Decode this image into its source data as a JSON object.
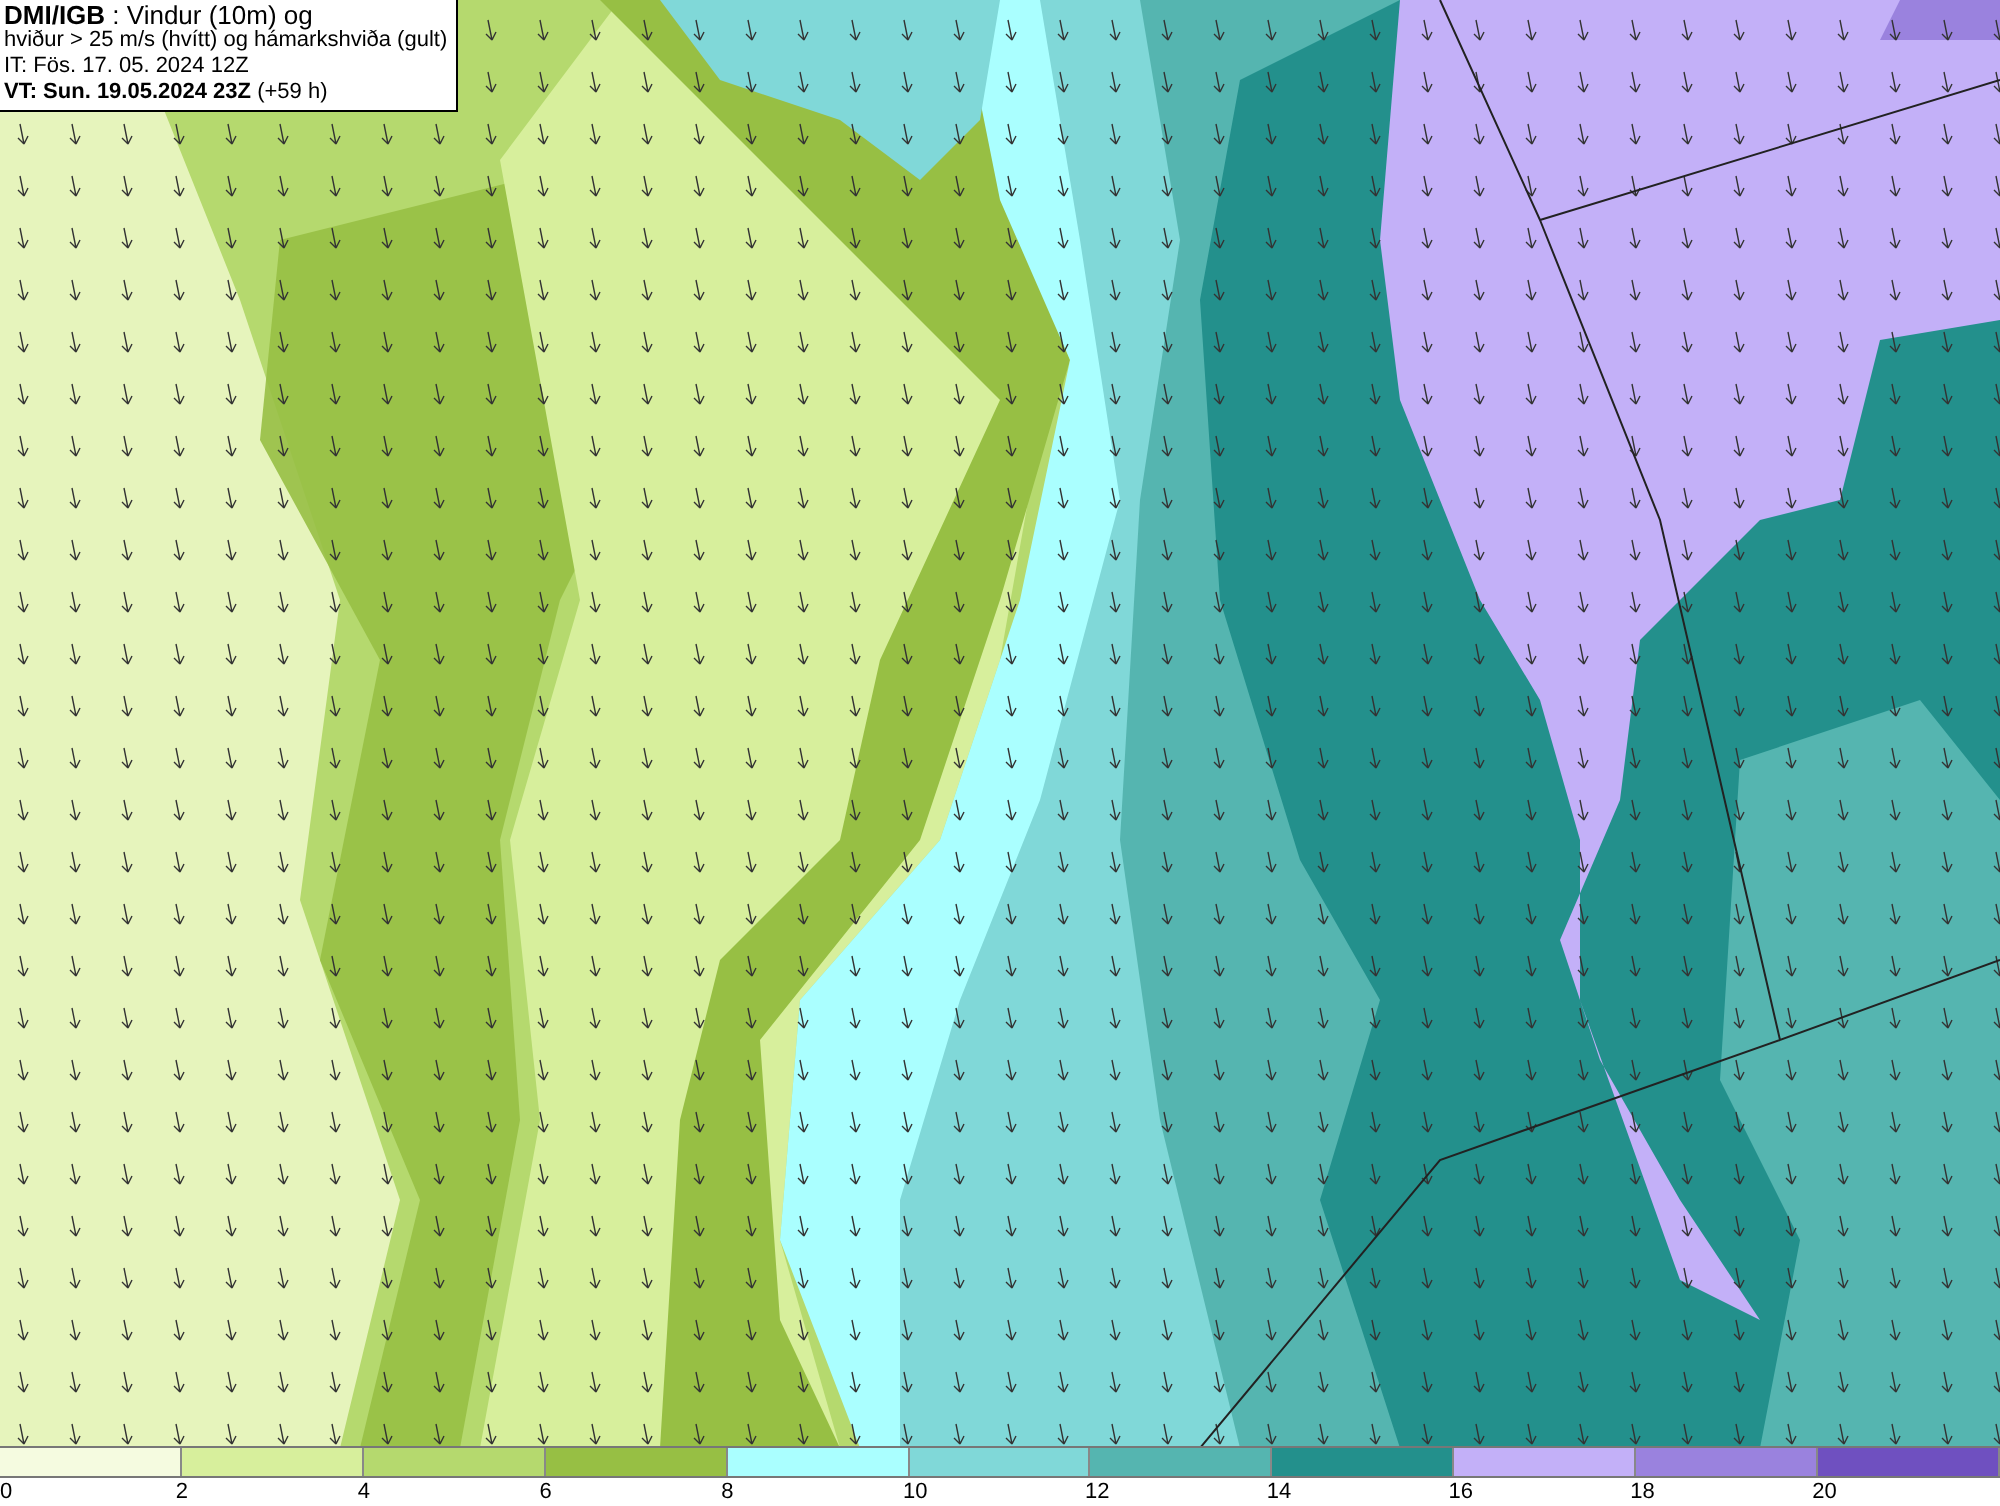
{
  "header": {
    "lines": [
      "**DMI/IGB** : Vindur (10m) og",
      "hviður > 25 m/s (hvítt) og hámarkshviða (gult)",
      "IT: Fös. 17. 05. 2024 12Z",
      "**VT: Sun. 19.05.2024 23Z** (+59 h)"
    ]
  },
  "legend": {
    "bins": [
      {
        "label": "0",
        "color": "#f5fbe0"
      },
      {
        "label": "2",
        "color": "#d7ef9c"
      },
      {
        "label": "4",
        "color": "#b5d96e"
      },
      {
        "label": "6",
        "color": "#97bf44"
      },
      {
        "label": "8",
        "color": "#aaffff"
      },
      {
        "label": "10",
        "color": "#80d8d8"
      },
      {
        "label": "12",
        "color": "#55b5b0"
      },
      {
        "label": "14",
        "color": "#23908c"
      },
      {
        "label": "16",
        "color": "#c3b0f8"
      },
      {
        "label": "18",
        "color": "#9a82de"
      },
      {
        "label": "20",
        "color": "#6f50c0"
      }
    ]
  }
}
